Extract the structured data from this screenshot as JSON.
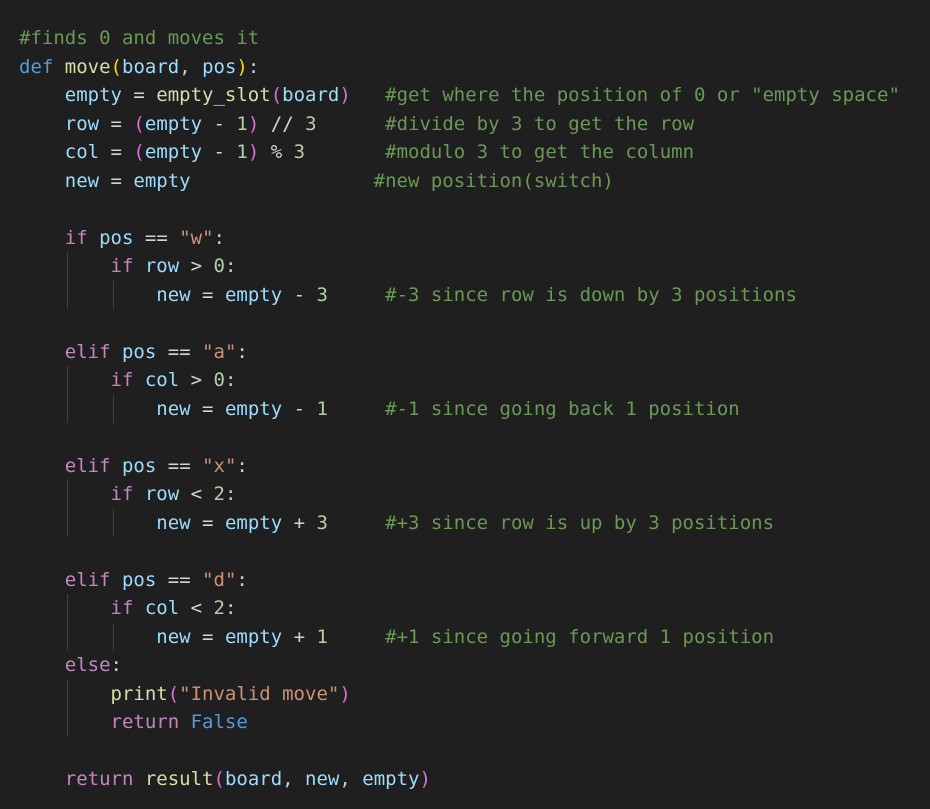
{
  "editor": {
    "lines": [
      [
        {
          "t": "#finds 0 and moves it",
          "c": "comment"
        }
      ],
      [
        {
          "t": "def",
          "c": "keyword"
        },
        {
          "t": " ",
          "c": "plain"
        },
        {
          "t": "move",
          "c": "func"
        },
        {
          "t": "(",
          "c": "paren1"
        },
        {
          "t": "board",
          "c": "var"
        },
        {
          "t": ", ",
          "c": "plain"
        },
        {
          "t": "pos",
          "c": "var"
        },
        {
          "t": ")",
          "c": "paren1"
        },
        {
          "t": ":",
          "c": "plain"
        }
      ],
      [
        {
          "t": "    ",
          "c": "plain"
        },
        {
          "t": "empty",
          "c": "var"
        },
        {
          "t": " = ",
          "c": "op"
        },
        {
          "t": "empty_slot",
          "c": "func"
        },
        {
          "t": "(",
          "c": "paren2"
        },
        {
          "t": "board",
          "c": "var"
        },
        {
          "t": ")",
          "c": "paren2"
        },
        {
          "t": "   ",
          "c": "plain"
        },
        {
          "t": "#get where the position of 0 or \"empty space\"",
          "c": "comment"
        }
      ],
      [
        {
          "t": "    ",
          "c": "plain"
        },
        {
          "t": "row",
          "c": "var"
        },
        {
          "t": " = ",
          "c": "op"
        },
        {
          "t": "(",
          "c": "paren2"
        },
        {
          "t": "empty",
          "c": "var"
        },
        {
          "t": " - ",
          "c": "op"
        },
        {
          "t": "1",
          "c": "num"
        },
        {
          "t": ")",
          "c": "paren2"
        },
        {
          "t": " // ",
          "c": "op"
        },
        {
          "t": "3",
          "c": "num"
        },
        {
          "t": "      ",
          "c": "plain"
        },
        {
          "t": "#divide by 3 to get the row",
          "c": "comment"
        }
      ],
      [
        {
          "t": "    ",
          "c": "plain"
        },
        {
          "t": "col",
          "c": "var"
        },
        {
          "t": " = ",
          "c": "op"
        },
        {
          "t": "(",
          "c": "paren2"
        },
        {
          "t": "empty",
          "c": "var"
        },
        {
          "t": " - ",
          "c": "op"
        },
        {
          "t": "1",
          "c": "num"
        },
        {
          "t": ")",
          "c": "paren2"
        },
        {
          "t": " % ",
          "c": "op"
        },
        {
          "t": "3",
          "c": "num"
        },
        {
          "t": "       ",
          "c": "plain"
        },
        {
          "t": "#modulo 3 to get the column",
          "c": "comment"
        }
      ],
      [
        {
          "t": "    ",
          "c": "plain"
        },
        {
          "t": "new",
          "c": "var"
        },
        {
          "t": " = ",
          "c": "op"
        },
        {
          "t": "empty",
          "c": "var"
        },
        {
          "t": "                ",
          "c": "plain"
        },
        {
          "t": "#new position(switch)",
          "c": "comment"
        }
      ],
      [
        {
          "t": "",
          "c": "plain"
        }
      ],
      [
        {
          "t": "    ",
          "c": "plain"
        },
        {
          "t": "if",
          "c": "control"
        },
        {
          "t": " ",
          "c": "plain"
        },
        {
          "t": "pos",
          "c": "var"
        },
        {
          "t": " == ",
          "c": "op"
        },
        {
          "t": "\"w\"",
          "c": "str"
        },
        {
          "t": ":",
          "c": "plain"
        }
      ],
      [
        {
          "t": "        ",
          "c": "plain"
        },
        {
          "t": "if",
          "c": "control"
        },
        {
          "t": " ",
          "c": "plain"
        },
        {
          "t": "row",
          "c": "var"
        },
        {
          "t": " > ",
          "c": "op"
        },
        {
          "t": "0",
          "c": "num"
        },
        {
          "t": ":",
          "c": "plain"
        }
      ],
      [
        {
          "t": "            ",
          "c": "plain"
        },
        {
          "t": "new",
          "c": "var"
        },
        {
          "t": " = ",
          "c": "op"
        },
        {
          "t": "empty",
          "c": "var"
        },
        {
          "t": " - ",
          "c": "op"
        },
        {
          "t": "3",
          "c": "num"
        },
        {
          "t": "     ",
          "c": "plain"
        },
        {
          "t": "#-3 since row is down by 3 positions",
          "c": "comment"
        }
      ],
      [
        {
          "t": "",
          "c": "plain"
        }
      ],
      [
        {
          "t": "    ",
          "c": "plain"
        },
        {
          "t": "elif",
          "c": "control"
        },
        {
          "t": " ",
          "c": "plain"
        },
        {
          "t": "pos",
          "c": "var"
        },
        {
          "t": " == ",
          "c": "op"
        },
        {
          "t": "\"a\"",
          "c": "str"
        },
        {
          "t": ":",
          "c": "plain"
        }
      ],
      [
        {
          "t": "        ",
          "c": "plain"
        },
        {
          "t": "if",
          "c": "control"
        },
        {
          "t": " ",
          "c": "plain"
        },
        {
          "t": "col",
          "c": "var"
        },
        {
          "t": " > ",
          "c": "op"
        },
        {
          "t": "0",
          "c": "num"
        },
        {
          "t": ":",
          "c": "plain"
        }
      ],
      [
        {
          "t": "            ",
          "c": "plain"
        },
        {
          "t": "new",
          "c": "var"
        },
        {
          "t": " = ",
          "c": "op"
        },
        {
          "t": "empty",
          "c": "var"
        },
        {
          "t": " - ",
          "c": "op"
        },
        {
          "t": "1",
          "c": "num"
        },
        {
          "t": "     ",
          "c": "plain"
        },
        {
          "t": "#-1 since going back 1 position",
          "c": "comment"
        }
      ],
      [
        {
          "t": "",
          "c": "plain"
        }
      ],
      [
        {
          "t": "    ",
          "c": "plain"
        },
        {
          "t": "elif",
          "c": "control"
        },
        {
          "t": " ",
          "c": "plain"
        },
        {
          "t": "pos",
          "c": "var"
        },
        {
          "t": " == ",
          "c": "op"
        },
        {
          "t": "\"x\"",
          "c": "str"
        },
        {
          "t": ":",
          "c": "plain"
        }
      ],
      [
        {
          "t": "        ",
          "c": "plain"
        },
        {
          "t": "if",
          "c": "control"
        },
        {
          "t": " ",
          "c": "plain"
        },
        {
          "t": "row",
          "c": "var"
        },
        {
          "t": " < ",
          "c": "op"
        },
        {
          "t": "2",
          "c": "num"
        },
        {
          "t": ":",
          "c": "plain"
        }
      ],
      [
        {
          "t": "            ",
          "c": "plain"
        },
        {
          "t": "new",
          "c": "var"
        },
        {
          "t": " = ",
          "c": "op"
        },
        {
          "t": "empty",
          "c": "var"
        },
        {
          "t": " + ",
          "c": "op"
        },
        {
          "t": "3",
          "c": "num"
        },
        {
          "t": "     ",
          "c": "plain"
        },
        {
          "t": "#+3 since row is up by 3 positions",
          "c": "comment"
        }
      ],
      [
        {
          "t": "",
          "c": "plain"
        }
      ],
      [
        {
          "t": "    ",
          "c": "plain"
        },
        {
          "t": "elif",
          "c": "control"
        },
        {
          "t": " ",
          "c": "plain"
        },
        {
          "t": "pos",
          "c": "var"
        },
        {
          "t": " == ",
          "c": "op"
        },
        {
          "t": "\"d\"",
          "c": "str"
        },
        {
          "t": ":",
          "c": "plain"
        }
      ],
      [
        {
          "t": "        ",
          "c": "plain"
        },
        {
          "t": "if",
          "c": "control"
        },
        {
          "t": " ",
          "c": "plain"
        },
        {
          "t": "col",
          "c": "var"
        },
        {
          "t": " < ",
          "c": "op"
        },
        {
          "t": "2",
          "c": "num"
        },
        {
          "t": ":",
          "c": "plain"
        }
      ],
      [
        {
          "t": "            ",
          "c": "plain"
        },
        {
          "t": "new",
          "c": "var"
        },
        {
          "t": " = ",
          "c": "op"
        },
        {
          "t": "empty",
          "c": "var"
        },
        {
          "t": " + ",
          "c": "op"
        },
        {
          "t": "1",
          "c": "num"
        },
        {
          "t": "     ",
          "c": "plain"
        },
        {
          "t": "#+1 since going forward 1 position",
          "c": "comment"
        }
      ],
      [
        {
          "t": "    ",
          "c": "plain"
        },
        {
          "t": "else",
          "c": "control"
        },
        {
          "t": ":",
          "c": "plain"
        }
      ],
      [
        {
          "t": "        ",
          "c": "plain"
        },
        {
          "t": "print",
          "c": "func"
        },
        {
          "t": "(",
          "c": "paren2"
        },
        {
          "t": "\"Invalid move\"",
          "c": "str"
        },
        {
          "t": ")",
          "c": "paren2"
        }
      ],
      [
        {
          "t": "        ",
          "c": "plain"
        },
        {
          "t": "return",
          "c": "control"
        },
        {
          "t": " ",
          "c": "plain"
        },
        {
          "t": "False",
          "c": "const"
        }
      ],
      [
        {
          "t": "",
          "c": "plain"
        }
      ],
      [
        {
          "t": "    ",
          "c": "plain"
        },
        {
          "t": "return",
          "c": "control"
        },
        {
          "t": " ",
          "c": "plain"
        },
        {
          "t": "result",
          "c": "func"
        },
        {
          "t": "(",
          "c": "paren2"
        },
        {
          "t": "board",
          "c": "var"
        },
        {
          "t": ", ",
          "c": "plain"
        },
        {
          "t": "new",
          "c": "var"
        },
        {
          "t": ", ",
          "c": "plain"
        },
        {
          "t": "empty",
          "c": "var"
        },
        {
          "t": ")",
          "c": "paren2"
        }
      ]
    ]
  }
}
